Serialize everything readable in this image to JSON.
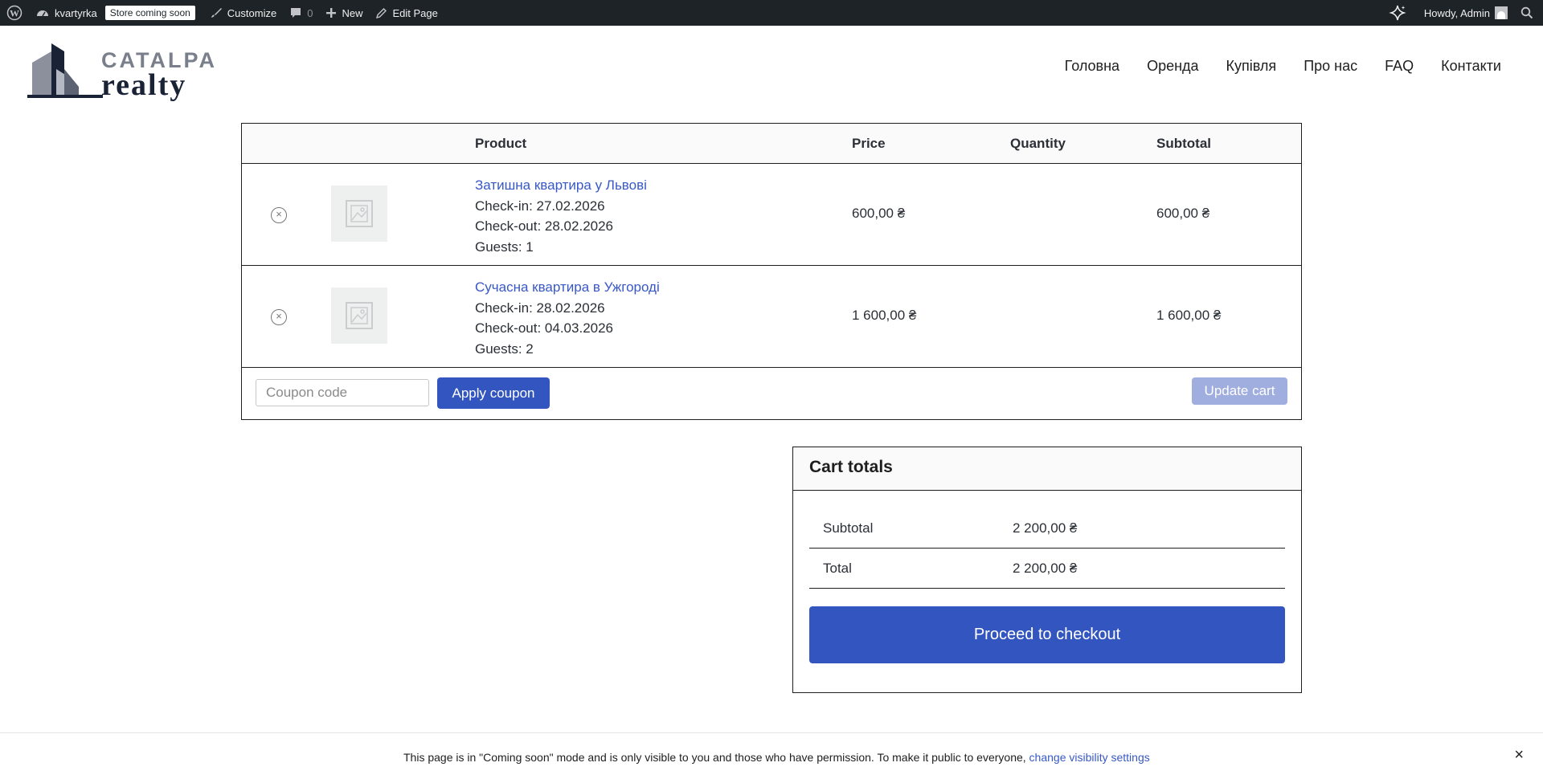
{
  "adminbar": {
    "site_name": "kvartyrka",
    "store_badge": "Store coming soon",
    "customize": "Customize",
    "comments_count": "0",
    "new": "New",
    "edit_page": "Edit Page",
    "howdy": "Howdy, Admin"
  },
  "header": {
    "logo_line1": "CATALPA",
    "logo_line2": "realty",
    "nav": [
      "Головна",
      "Оренда",
      "Купівля",
      "Про нас",
      "FAQ",
      "Контакти"
    ]
  },
  "cart": {
    "columns": {
      "product": "Product",
      "price": "Price",
      "quantity": "Quantity",
      "subtotal": "Subtotal"
    },
    "items": [
      {
        "name": "Затишна квартира у Львові",
        "checkin": "Check-in: 27.02.2026",
        "checkout": "Check-out: 28.02.2026",
        "guests": "Guests: 1",
        "price": "600,00 ₴",
        "subtotal": "600,00 ₴"
      },
      {
        "name": "Сучасна квартира в Ужгороді",
        "checkin": "Check-in: 28.02.2026",
        "checkout": "Check-out: 04.03.2026",
        "guests": "Guests: 2",
        "price": "1 600,00 ₴",
        "subtotal": "1 600,00 ₴"
      }
    ],
    "coupon_placeholder": "Coupon code",
    "apply_coupon": "Apply coupon",
    "update_cart": "Update cart"
  },
  "totals": {
    "title": "Cart totals",
    "subtotal_label": "Subtotal",
    "subtotal_value": "2 200,00 ₴",
    "total_label": "Total",
    "total_value": "2 200,00 ₴",
    "checkout": "Proceed to checkout"
  },
  "notice": {
    "text": "This page is in \"Coming soon\" mode and is only visible to you and those who have permission. To make it public to everyone, ",
    "link": "change visibility settings"
  },
  "colors": {
    "accent": "#3355bf",
    "accent_disabled": "#a0addf",
    "link": "#3858c7",
    "adminbar": "#1d2327"
  },
  "icons": [
    "wordpress-icon",
    "dashboard-icon",
    "brush-icon",
    "comment-icon",
    "plus-icon",
    "pencil-icon",
    "sparkle-icon",
    "search-icon",
    "remove-icon",
    "image-placeholder-icon",
    "close-icon"
  ]
}
